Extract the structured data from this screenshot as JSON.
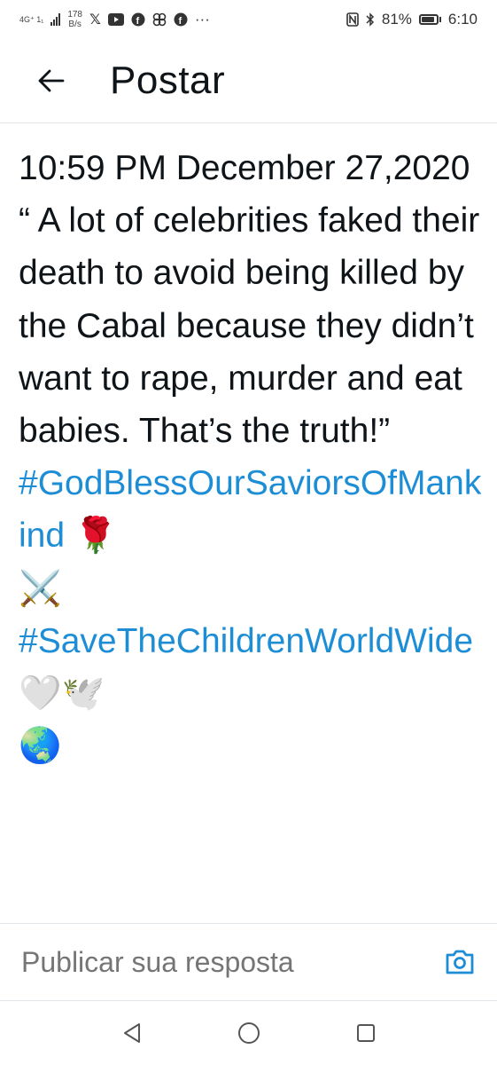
{
  "status_bar": {
    "network_label": "4G⁺ 1₁",
    "speed_value": "178",
    "speed_unit": "B/s",
    "app_icons": [
      "x-icon",
      "youtube-icon",
      "facebook-icon",
      "pinwheel-icon",
      "facebook-icon"
    ],
    "more": "···",
    "battery": "81%",
    "time": "6:10"
  },
  "header": {
    "title": "Postar"
  },
  "post": {
    "line1": "10:59 PM December 27,2020",
    "quote": "“ A lot of celebrities faked their death to avoid being killed by the Cabal because they didn’t want to rape, murder and eat babies. That’s the truth!”",
    "hashtag1": "#GodBlessOurSaviorsOfMankind",
    "emoji_rose": "🌹",
    "emoji_swords": "⚔️",
    "hashtag2": "#SaveTheChildrenWorldWide",
    "emoji_heart": "🤍",
    "emoji_dove": "🕊️",
    "emoji_globe": "🌏"
  },
  "reply": {
    "placeholder": "Publicar sua resposta"
  },
  "colors": {
    "accent": "#1d8ed6",
    "text": "#0f1419",
    "muted": "#536471"
  }
}
